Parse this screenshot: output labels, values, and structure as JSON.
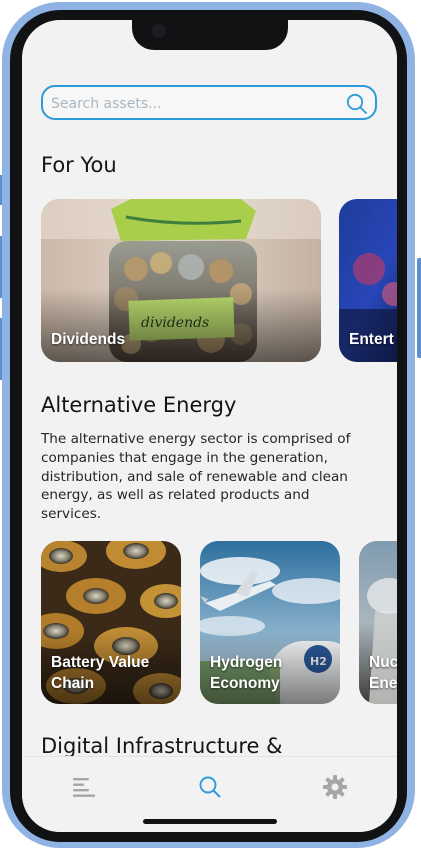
{
  "search": {
    "placeholder": "Search assets..."
  },
  "for_you": {
    "title": "For You",
    "cards": [
      {
        "label": "Dividends"
      },
      {
        "label": "Entert"
      }
    ]
  },
  "alternative_energy": {
    "title": "Alternative Energy",
    "description": "The alternative energy sector is comprised of companies that engage in the generation, distribution, and sale of renewable and clean energy, as well as related products and services.",
    "cards": [
      {
        "label": "Battery Value\nChain"
      },
      {
        "label": "Hydrogen\nEconomy"
      },
      {
        "label": "Nuc\nEne"
      }
    ]
  },
  "digital_infrastructure": {
    "title": "Digital Infrastructure &"
  },
  "photo_text": {
    "jar_label": "dividends"
  },
  "tabbar": {
    "items": [
      {
        "icon": "list-icon",
        "active": false
      },
      {
        "icon": "search-icon",
        "active": true
      },
      {
        "icon": "gear-icon",
        "active": false
      }
    ]
  },
  "colors": {
    "accent": "#2d9bd7",
    "background": "#f2f2f2",
    "inactive_icon": "#a6a6a6",
    "frame": "#8fb4e4"
  }
}
